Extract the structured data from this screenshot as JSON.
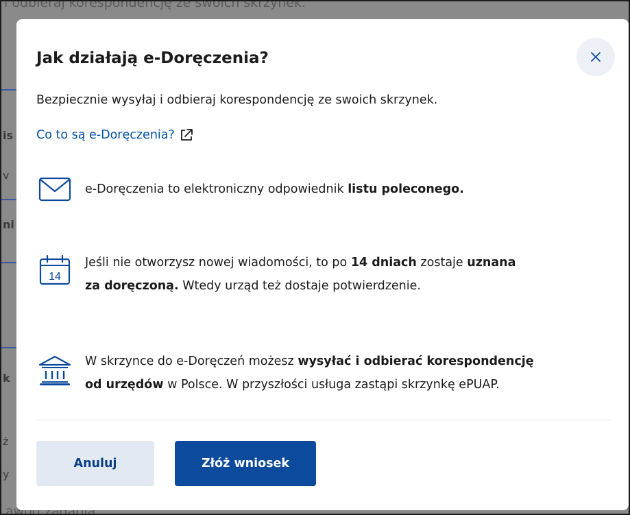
{
  "background": {
    "top_text": "i odbieraj korespondencję ze swoich skrzynek.",
    "bottom_text": "awod zadania",
    "fragments": [
      "is",
      "v",
      "ni",
      "k",
      "ż",
      "y"
    ]
  },
  "dialog": {
    "title": "Jak działają e-Doręczenia?",
    "close_icon": "close-icon",
    "intro": "Bezpiecznie wysyłaj i odbieraj korespondencję ze swoich skrzynek.",
    "link_label": "Co to są e-Doręczenia?",
    "link_icon": "external-link-icon",
    "features": [
      {
        "icon": "envelope-icon",
        "text_before": "e-Doręczenia to elektroniczny odpowiednik ",
        "bold": "listu poleconego."
      },
      {
        "icon": "calendar-icon",
        "calendar_day": "14",
        "line1_before": "Jeśli nie otworzysz nowej wiadomości, to po ",
        "line1_bold1": "14 dniach",
        "line1_mid": " zostaje ",
        "line1_bold2": "uznana",
        "line2_bold": "za doręczoną.",
        "line2_after": " Wtedy urząd też dostaje potwierdzenie."
      },
      {
        "icon": "institution-icon",
        "line1_before": "W skrzynce do e-Doręczeń możesz ",
        "line1_bold": "wysyłać i odbierać korespondencję",
        "line2_bold": "od urzędów",
        "line2_after": " w Polsce. W przyszłości usługa zastąpi skrzynkę ePUAP."
      }
    ],
    "cancel_label": "Anuluj",
    "submit_label": "Złóż wniosek"
  },
  "colors": {
    "accent": "#0b4a9c",
    "link": "#0052a5",
    "secondary_button_bg": "#e2e9f3"
  }
}
